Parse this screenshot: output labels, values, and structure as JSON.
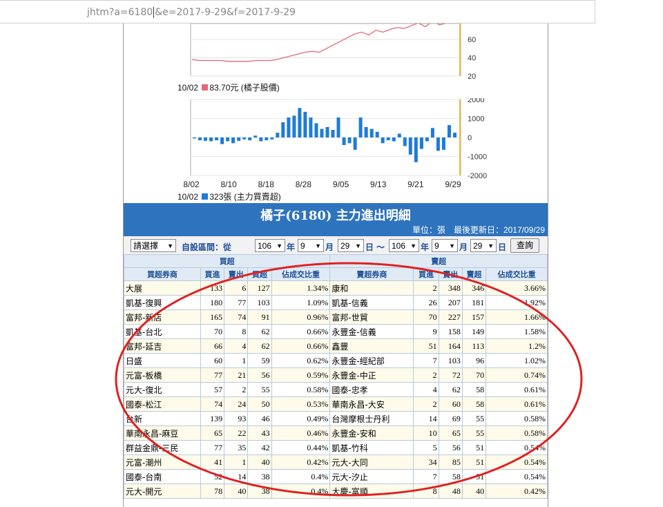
{
  "url_bar": {
    "before_caret": "jhtm?a=6180",
    "after_caret": "&e=2017-9-29&f=2017-9-29"
  },
  "price_chart": {
    "axis_ticks": [
      "60",
      "40",
      "20"
    ],
    "legend_date": "10/02",
    "legend_text": "83.70元 (橘子股價)",
    "color": "#e06a7a",
    "chart_data": {
      "type": "line",
      "series": [
        {
          "name": "橘子股價",
          "values": [
            38,
            37,
            37,
            37,
            37,
            36,
            36,
            36,
            36,
            37,
            37,
            37,
            38,
            40,
            42,
            44,
            46,
            47,
            46,
            50,
            54,
            58,
            62,
            66,
            68,
            65,
            70,
            68,
            71,
            73,
            72,
            75,
            78,
            74,
            80,
            76,
            78,
            79
          ]
        }
      ],
      "ylim": [
        20,
        85
      ]
    }
  },
  "volume_chart": {
    "axis_ticks": [
      "2000",
      "1000",
      "0",
      "-1000",
      "-2000"
    ],
    "x_ticks": [
      "8/02",
      "8/10",
      "8/18",
      "8/28",
      "9/05",
      "9/13",
      "9/21",
      "9/29"
    ],
    "legend_date": "10/02",
    "legend_text": "323張 (主力買賣超)",
    "color": "#1f7bd6",
    "chart_data": {
      "type": "bar",
      "values": [
        -50,
        -150,
        -180,
        -200,
        -150,
        -350,
        -200,
        -300,
        -180,
        -100,
        -150,
        100,
        -200,
        -150,
        -100,
        250,
        800,
        1050,
        1150,
        1550,
        1350,
        1050,
        750,
        450,
        550,
        400,
        1050,
        -400,
        -300,
        -650,
        1050,
        550,
        450,
        300,
        -300,
        -150,
        -200,
        200,
        -450,
        -900,
        -1300,
        -600,
        -200,
        500,
        -700,
        -650,
        650,
        250
      ],
      "ylim": [
        -2000,
        2000
      ]
    }
  },
  "title": "橘子(6180) 主力進出明細",
  "unit_text": "單位：張　最後更新日：2017/09/29",
  "filter": {
    "preset": "請選擇",
    "custom_label": "自設區間：從",
    "from_year": "106",
    "year_label": "年",
    "from_month": "9",
    "month_label": "月",
    "from_day": "29",
    "day_label": "日",
    "tilde": "～",
    "to_year": "106",
    "to_month": "9",
    "to_day": "29",
    "query_button": "查詢"
  },
  "table": {
    "buy_group": "買超",
    "sell_group": "賣超",
    "headers": [
      "買超券商",
      "買進",
      "賣出",
      "買超",
      "佔成交比重",
      "賣超券商",
      "買進",
      "賣出",
      "賣超",
      "佔成交比重"
    ],
    "rows": [
      [
        "大展",
        "133",
        "6",
        "127",
        "1.34%",
        "康和",
        "2",
        "348",
        "346",
        "3.66%"
      ],
      [
        "凱基-復興",
        "180",
        "77",
        "103",
        "1.09%",
        "凱基-信義",
        "26",
        "207",
        "181",
        "1.92%"
      ],
      [
        "富邦-新店",
        "165",
        "74",
        "91",
        "0.96%",
        "富邦-世貿",
        "70",
        "227",
        "157",
        "1.66%"
      ],
      [
        "凱基-台北",
        "70",
        "8",
        "62",
        "0.66%",
        "永豐金-信義",
        "9",
        "158",
        "149",
        "1.58%"
      ],
      [
        "富邦-延吉",
        "66",
        "4",
        "62",
        "0.66%",
        "鑫豐",
        "51",
        "164",
        "113",
        "1.2%"
      ],
      [
        "日盛",
        "60",
        "1",
        "59",
        "0.62%",
        "永豐金-經紀部",
        "7",
        "103",
        "96",
        "1.02%"
      ],
      [
        "元富-板橋",
        "77",
        "21",
        "56",
        "0.59%",
        "永豐金-中正",
        "2",
        "72",
        "70",
        "0.74%"
      ],
      [
        "元大-復北",
        "57",
        "2",
        "55",
        "0.58%",
        "國泰-忠孝",
        "4",
        "62",
        "58",
        "0.61%"
      ],
      [
        "國泰-松江",
        "74",
        "24",
        "50",
        "0.53%",
        "華南永昌-大安",
        "2",
        "60",
        "58",
        "0.61%"
      ],
      [
        "台新",
        "139",
        "93",
        "46",
        "0.49%",
        "台灣摩根士丹利",
        "14",
        "69",
        "55",
        "0.58%"
      ],
      [
        "華南永昌-麻豆",
        "65",
        "22",
        "43",
        "0.46%",
        "永豐金-安和",
        "10",
        "65",
        "55",
        "0.58%"
      ],
      [
        "群益金鼎-三民",
        "77",
        "35",
        "42",
        "0.44%",
        "凱基-竹科",
        "5",
        "56",
        "51",
        "0.54%"
      ],
      [
        "元富-潮州",
        "41",
        "1",
        "40",
        "0.42%",
        "元大-大同",
        "34",
        "85",
        "51",
        "0.54%"
      ],
      [
        "國泰-台南",
        "52",
        "14",
        "38",
        "0.4%",
        "元大-汐止",
        "7",
        "58",
        "51",
        "0.54%"
      ],
      [
        "元大-開元",
        "78",
        "40",
        "38",
        "0.4%",
        "大慶-富順",
        "8",
        "48",
        "40",
        "0.42%"
      ]
    ]
  },
  "annotation": {
    "color": "#e02020"
  }
}
